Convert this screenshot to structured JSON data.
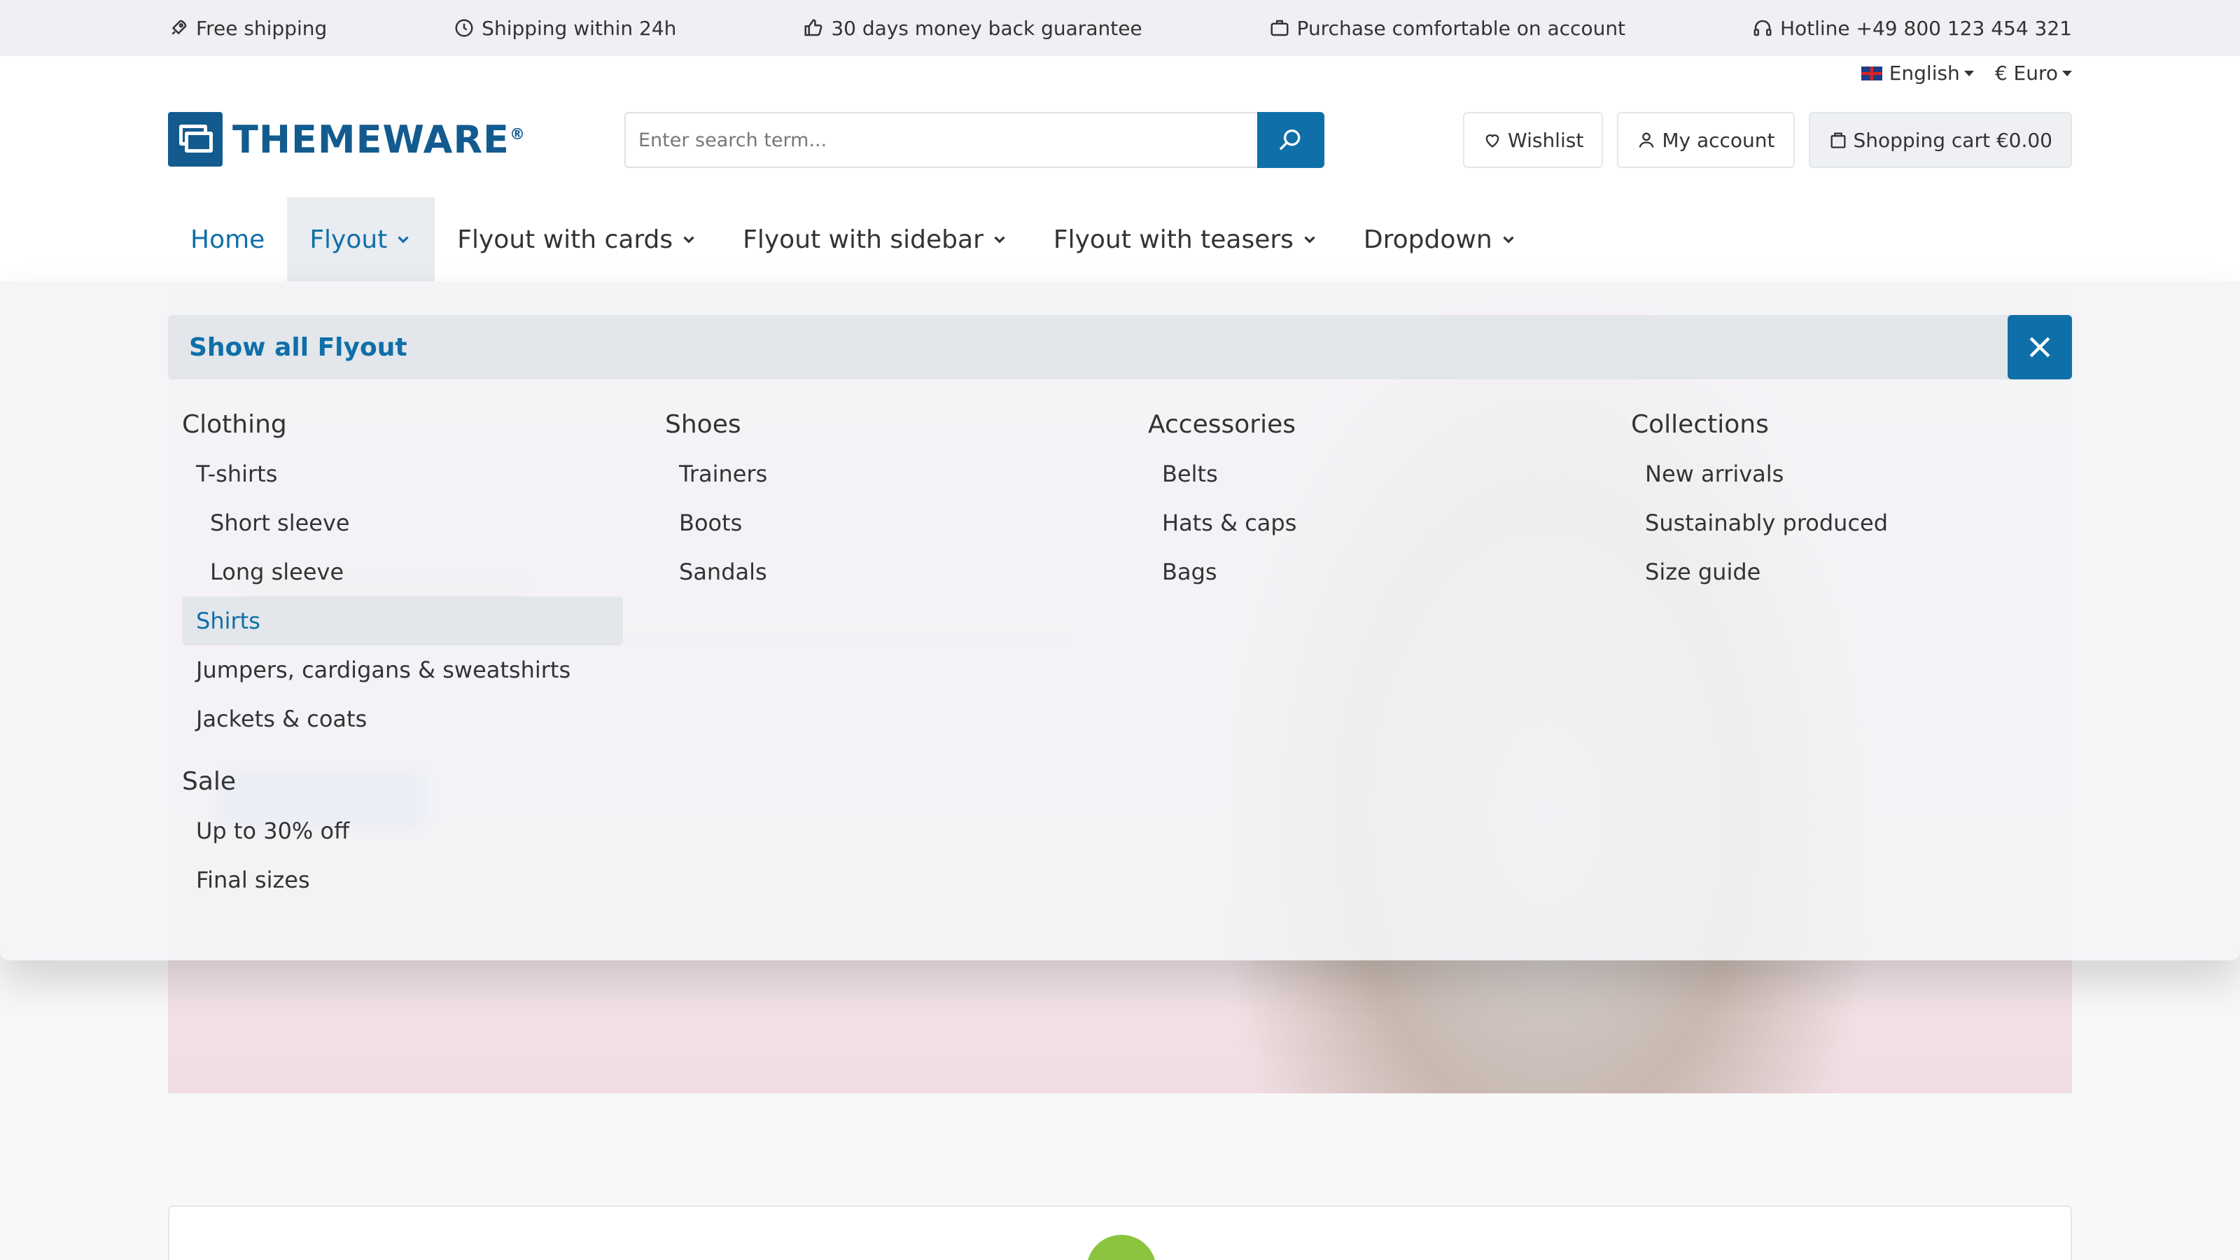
{
  "topbar": {
    "usps": [
      {
        "icon": "rocket-icon",
        "text": "Free shipping"
      },
      {
        "icon": "clock-icon",
        "text": "Shipping within 24h"
      },
      {
        "icon": "thumbs-up-icon",
        "text": "30 days money back guarantee"
      },
      {
        "icon": "briefcase-icon",
        "text": "Purchase comfortable on account"
      },
      {
        "icon": "headset-icon",
        "text": "Hotline +49 800 123 454 321"
      }
    ]
  },
  "header": {
    "language": "English",
    "currency": "€ Euro",
    "logo_text": "THEMEWARE",
    "logo_reg": "®",
    "search_placeholder": "Enter search term...",
    "wishlist_label": "Wishlist",
    "account_label": "My account",
    "cart_label": "Shopping cart €0.00"
  },
  "nav": {
    "items": [
      {
        "label": "Home"
      },
      {
        "label": "Flyout"
      },
      {
        "label": "Flyout with cards"
      },
      {
        "label": "Flyout with sidebar"
      },
      {
        "label": "Flyout with teasers"
      },
      {
        "label": "Dropdown"
      }
    ]
  },
  "flyout": {
    "show_all_label": "Show all Flyout",
    "columns": [
      {
        "title": "Clothing",
        "items": [
          "T-shirts",
          "Short sleeve",
          "Long sleeve",
          "Shirts",
          "Jumpers, cardigans & sweatshirts",
          "Jackets & coats"
        ],
        "title2": "Sale",
        "items2": [
          "Up to 30% off",
          "Final sizes"
        ]
      },
      {
        "title": "Shoes",
        "items": [
          "Trainers",
          "Boots",
          "Sandals"
        ]
      },
      {
        "title": "Accessories",
        "items": [
          "Belts",
          "Hats & caps",
          "Bags"
        ]
      },
      {
        "title": "Collections",
        "items": [
          "New arrivals",
          "Sustainably produced",
          "Size guide"
        ]
      }
    ]
  },
  "colors": {
    "brand": "#135b8f",
    "accent": "#0f6fa8",
    "topbar_bg": "#eef0f3"
  }
}
